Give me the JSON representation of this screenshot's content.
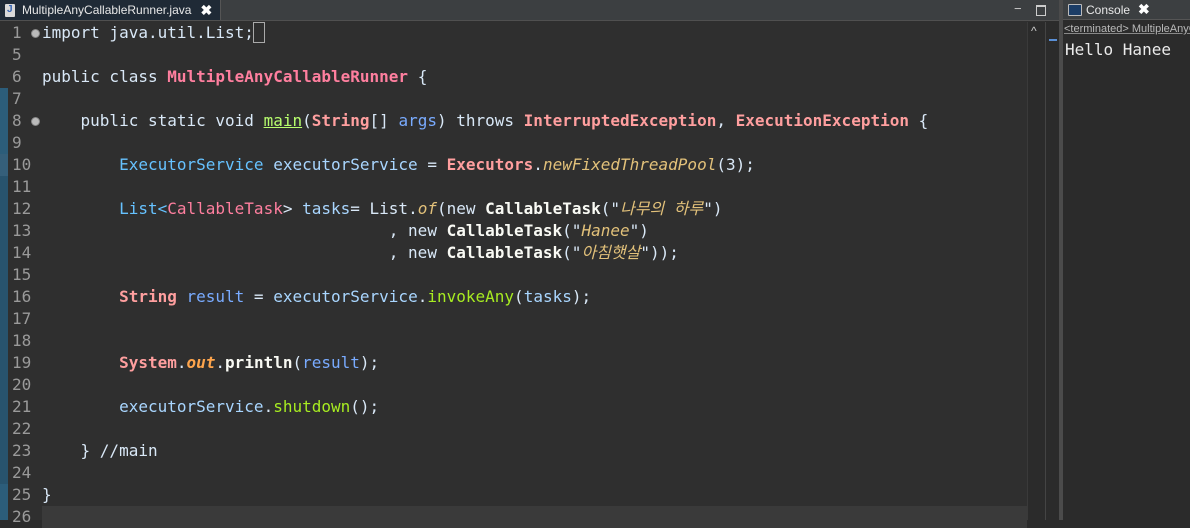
{
  "editor": {
    "tab_label": "MultipleAnyCallableRunner.java",
    "close_glyph": "✖",
    "minimize_glyph": "−",
    "scroll_up_glyph": "^"
  },
  "gutter": {
    "line_numbers": [
      "1",
      "5",
      "6",
      "7",
      "8",
      "9",
      "10",
      "11",
      "12",
      "13",
      "14",
      "15",
      "16",
      "17",
      "18",
      "19",
      "20",
      "21",
      "22",
      "23",
      "24",
      "25",
      "26"
    ]
  },
  "code_lines": {
    "l1": "import java.util.List;",
    "l6a": "public class ",
    "l6b": "MultipleAnyCallableRunner",
    "l6c": " {",
    "l8a": "    public static void ",
    "l8b": "main",
    "l8c": "(",
    "l8d": "String",
    "l8e": "[] ",
    "l8f": "args",
    "l8g": ") throws ",
    "l8h": "InterruptedException",
    "l8i": ", ",
    "l8j": "ExecutionException",
    "l8k": " {",
    "l10a": "        ExecutorService ",
    "l10b": "executorService",
    "l10c": " = ",
    "l10d": "Executors",
    "l10e": ".",
    "l10f": "newFixedThreadPool",
    "l10g": "(3);",
    "l12a": "        List<",
    "l12b": "CallableTask",
    "l12c": "> ",
    "l12d": "tasks",
    "l12e": "= List.",
    "l12f": "of",
    "l12g": "(new ",
    "l12h": "CallableTask",
    "l12i": "(\"",
    "l12j": "나무의 하루",
    "l12k": "\")",
    "l13a": "                                    , new ",
    "l13b": "CallableTask",
    "l13c": "(\"",
    "l13d": "Hanee",
    "l13e": "\")",
    "l14a": "                                    , new ",
    "l14b": "CallableTask",
    "l14c": "(\"",
    "l14d": "아침햇살",
    "l14e": "\"));",
    "l16a": "        ",
    "l16b": "String",
    "l16c": " ",
    "l16d": "result",
    "l16e": " = ",
    "l16f": "executorService",
    "l16g": ".",
    "l16h": "invokeAny",
    "l16i": "(",
    "l16j": "tasks",
    "l16k": ");",
    "l19a": "        ",
    "l19b": "System",
    "l19c": ".",
    "l19d": "out",
    "l19e": ".",
    "l19f": "println",
    "l19g": "(",
    "l19h": "result",
    "l19i": ");",
    "l21a": "        ",
    "l21b": "executorService",
    "l21c": ".",
    "l21d": "shutdown",
    "l21e": "();",
    "l23": "    } //main",
    "l25": "}"
  },
  "console": {
    "tab_label": "Console",
    "close_glyph": "✖",
    "status": "<terminated> MultipleAnyCallableRunner",
    "output": "Hello Hanee"
  },
  "colors": {
    "editor_bg": "#2f2f2f",
    "keyword": "#d9e8f7",
    "class_name": "#ff7f9f",
    "string_italic": "#e2c17a",
    "static_field": "#ffa54c"
  }
}
